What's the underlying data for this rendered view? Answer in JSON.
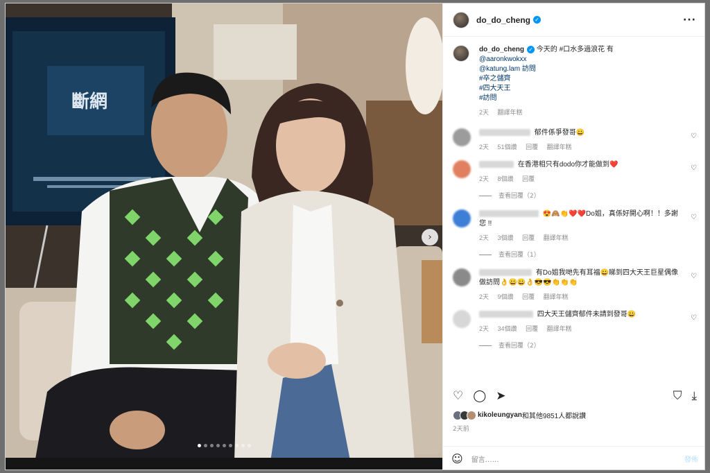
{
  "post": {
    "author": "do_do_cheng",
    "verified_icon": "verified-badge-icon",
    "more_label": "···"
  },
  "photo": {
    "slide_count": 9,
    "active_slide": 1,
    "poster_text": "斷網"
  },
  "caption": {
    "author": "do_do_cheng",
    "line1": "今天的 #口水多過浪花 有",
    "line2": "@aaronkwokxx",
    "line3": "@katung.lam 訪問",
    "line4": "#卒之儲齊",
    "line5": "#四大天王",
    "line6": "#訪問",
    "time": "2天",
    "translate": "翻譯年糕"
  },
  "comments": [
    {
      "text": "郁件係爭發哥😀",
      "time": "2天",
      "likes": "51個讚",
      "reply": "回覆",
      "translate": "翻譯年糕",
      "replies": ""
    },
    {
      "text": "在香港相只有dodo你才能做到❤️",
      "time": "2天",
      "likes": "8個讚",
      "reply": "回覆",
      "translate": "",
      "replies": "查看回覆（2）"
    },
    {
      "text": "😍🙈👏❤️❤️Do姐，真係好開心啊！！多謝您 !!",
      "time": "2天",
      "likes": "3個讚",
      "reply": "回覆",
      "translate": "翻譯年糕",
      "replies": "查看回覆（1）"
    },
    {
      "text": "有Do姐我哋先有耳福😀睇到四大天王巨星偶像做訪問👌😀😀👌😎😎👏👏👏",
      "time": "2天",
      "likes": "9個讚",
      "reply": "回覆",
      "translate": "翻譯年糕",
      "replies": ""
    },
    {
      "text": "四大天王儲齊郁件未請到發哥😀",
      "time": "2天",
      "likes": "34個讚",
      "reply": "回覆",
      "translate": "翻譯年糕",
      "replies": "查看回覆（2）"
    }
  ],
  "likes_line": {
    "user": "kikoleungyan",
    "rest": "和其他9851人都說讚"
  },
  "date": "2天前",
  "comment_box": {
    "placeholder": "留言……",
    "post": "發佈"
  },
  "colors": {
    "verified": "#0095f6",
    "link": "#00376b",
    "muted": "#8e8e8e",
    "heart_red": "#ed4956"
  }
}
